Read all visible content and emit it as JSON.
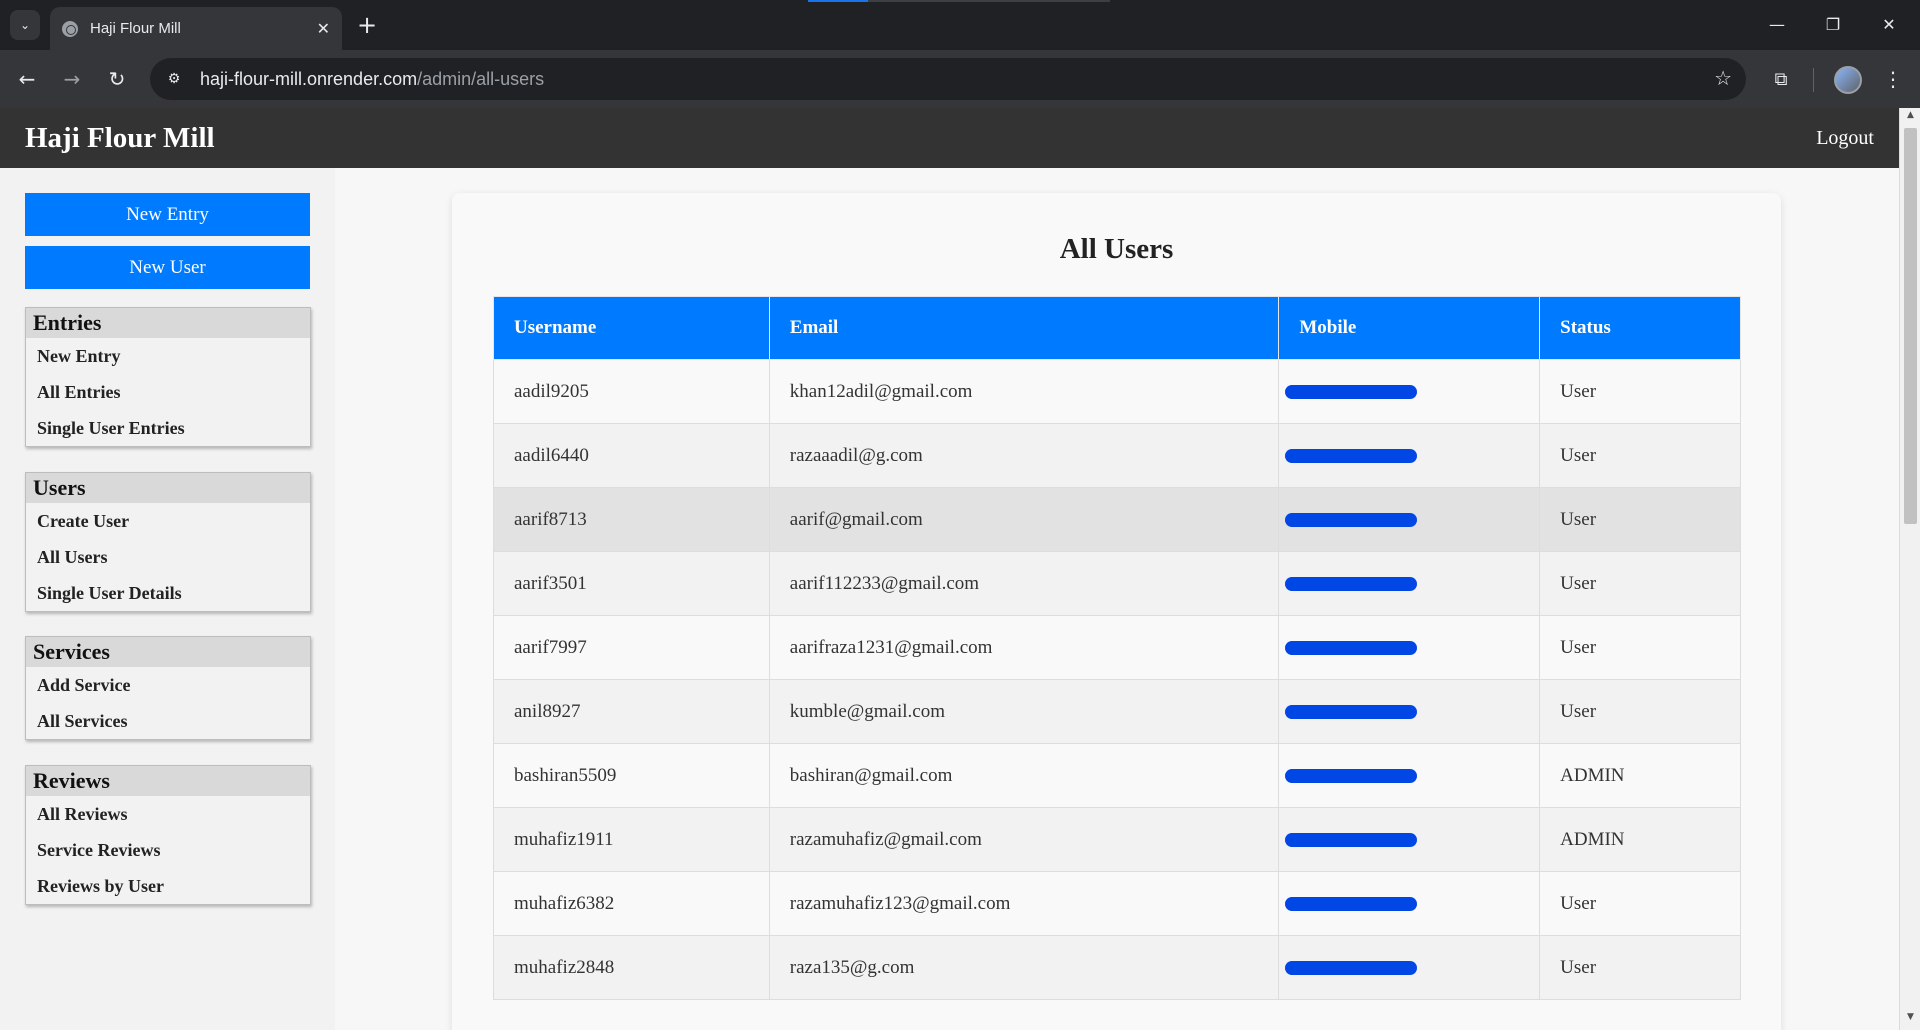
{
  "browser": {
    "tab_title": "Haji Flour Mill",
    "url_host": "haji-flour-mill.onrender.com",
    "url_path": "/admin/all-users"
  },
  "header": {
    "brand": "Haji Flour Mill",
    "logout": "Logout"
  },
  "sidebar": {
    "buttons": [
      "New Entry",
      "New User"
    ],
    "sections": [
      {
        "title": "Entries",
        "items": [
          "New Entry",
          "All Entries",
          "Single User Entries"
        ]
      },
      {
        "title": "Users",
        "items": [
          "Create User",
          "All Users",
          "Single User Details"
        ]
      },
      {
        "title": "Services",
        "items": [
          "Add Service",
          "All Services"
        ]
      },
      {
        "title": "Reviews",
        "items": [
          "All Reviews",
          "Service Reviews",
          "Reviews by User"
        ]
      }
    ]
  },
  "main": {
    "title": "All Users",
    "columns": [
      "Username",
      "Email",
      "Mobile",
      "Status"
    ],
    "rows": [
      {
        "username": "aadil9205",
        "email": "khan12adil@gmail.com",
        "status": "User"
      },
      {
        "username": "aadil6440",
        "email": "razaaadil@g.com",
        "status": "User"
      },
      {
        "username": "aarif8713",
        "email": "aarif@gmail.com",
        "status": "User"
      },
      {
        "username": "aarif3501",
        "email": "aarif112233@gmail.com",
        "status": "User"
      },
      {
        "username": "aarif7997",
        "email": "aarifraza1231@gmail.com",
        "status": "User"
      },
      {
        "username": "anil8927",
        "email": "kumble@gmail.com",
        "status": "User"
      },
      {
        "username": "bashiran5509",
        "email": "bashiran@gmail.com",
        "status": "ADMIN"
      },
      {
        "username": "muhafiz1911",
        "email": "razamuhafiz@gmail.com",
        "status": "ADMIN"
      },
      {
        "username": "muhafiz6382",
        "email": "razamuhafiz123@gmail.com",
        "status": "User"
      },
      {
        "username": "muhafiz2848",
        "email": "raza135@g.com",
        "status": "User"
      }
    ]
  },
  "colors": {
    "accent": "#007bff",
    "header_bg": "#333333",
    "redaction": "#0047e6"
  }
}
